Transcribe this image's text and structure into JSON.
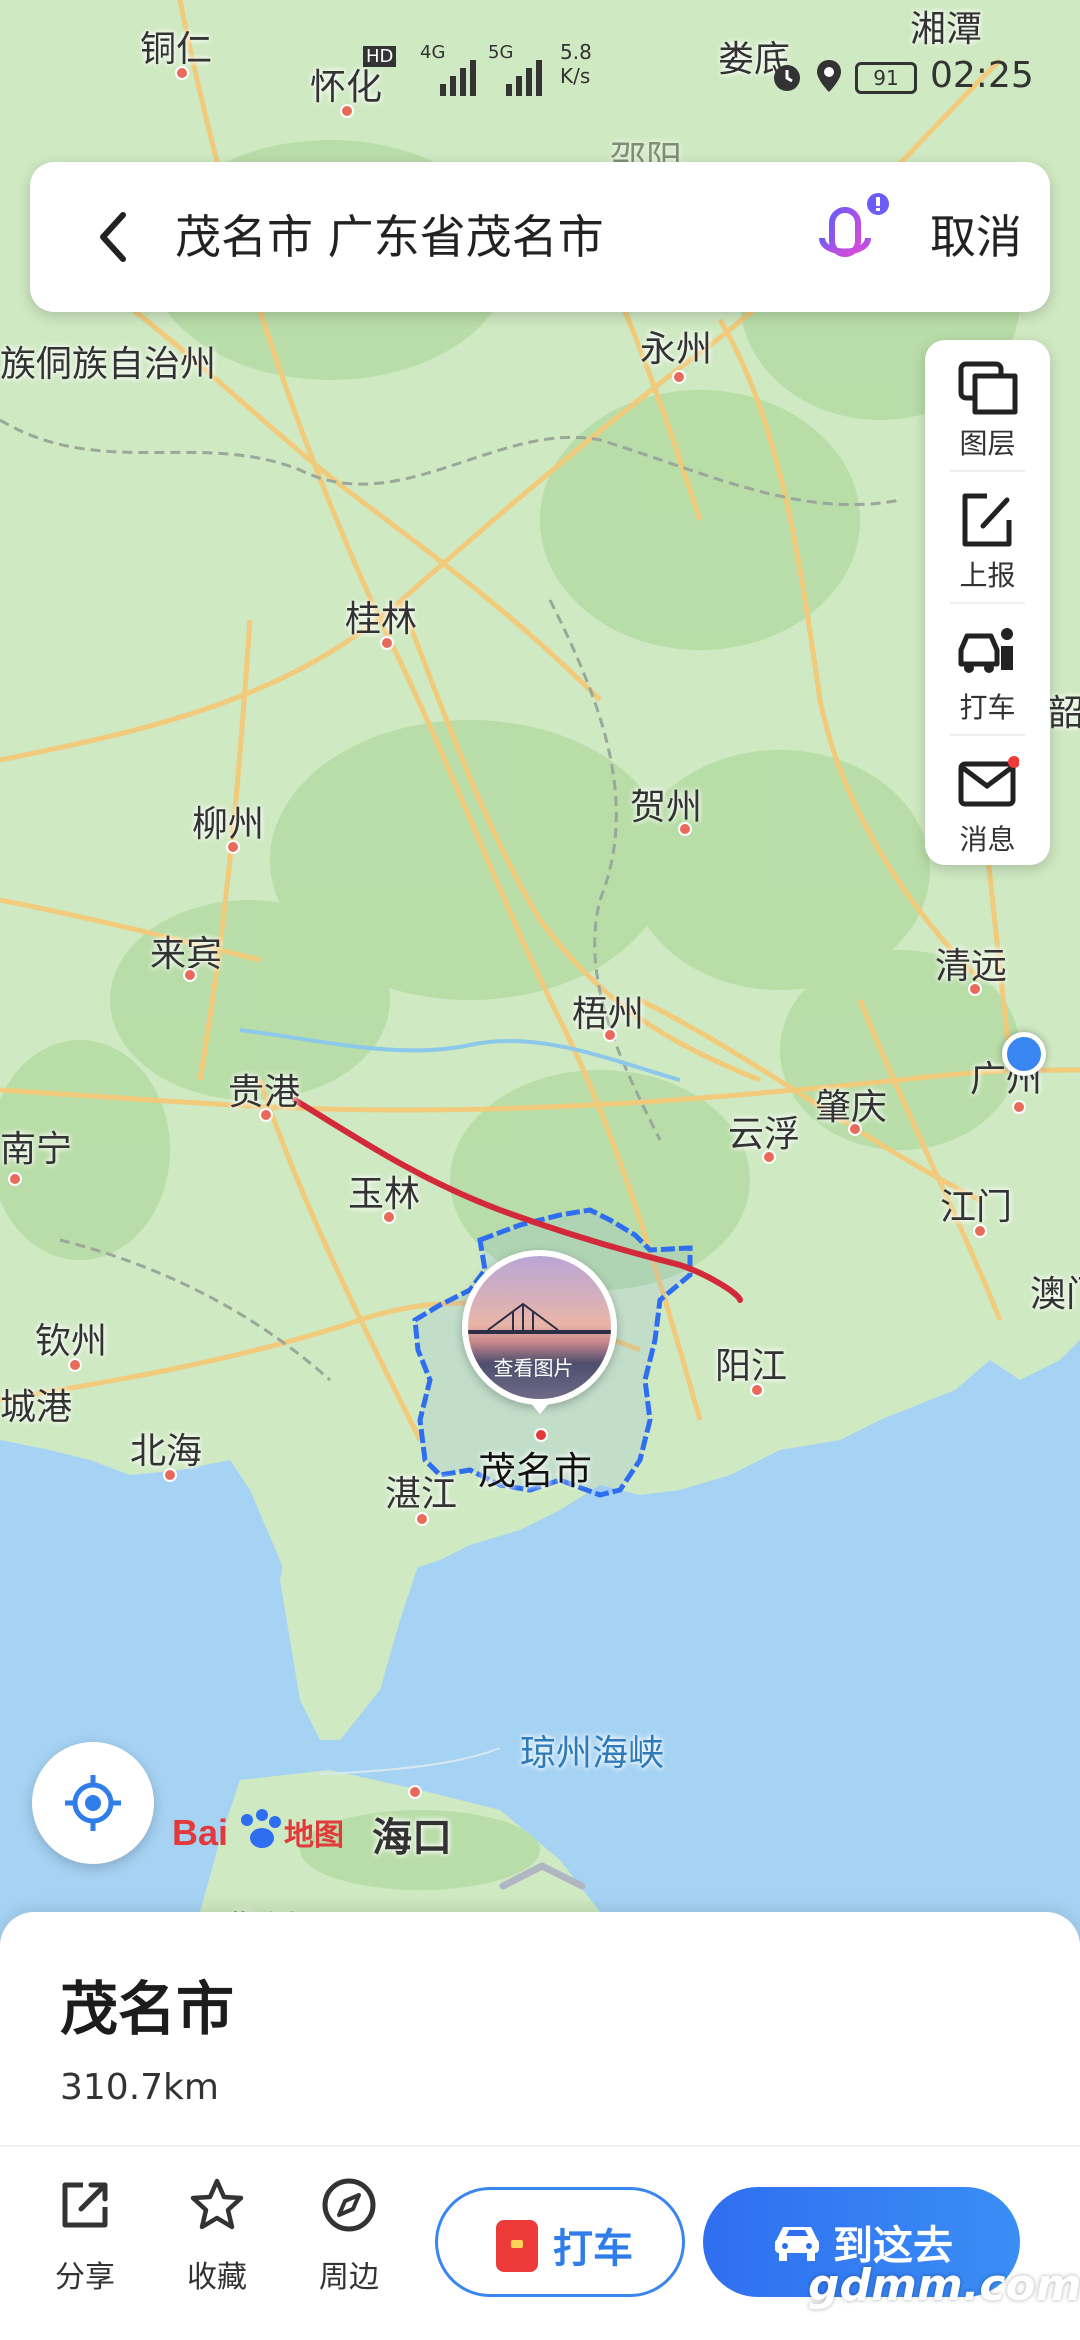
{
  "status_bar": {
    "signal_left": "HD",
    "net_4g": "4G",
    "net_5g": "5G",
    "speed": "5.8\nK/s",
    "battery": "91",
    "time": "02:25"
  },
  "search": {
    "query": "茂名市 广东省茂名市",
    "cancel_label": "取消"
  },
  "tools": [
    {
      "label": "图层",
      "icon": "layers-icon"
    },
    {
      "label": "上报",
      "icon": "report-edit-icon"
    },
    {
      "label": "打车",
      "icon": "taxi-driver-icon"
    },
    {
      "label": "消息",
      "icon": "mail-icon"
    }
  ],
  "map": {
    "labels": [
      {
        "text": "铜仁"
      },
      {
        "text": "怀化"
      },
      {
        "text": "娄底"
      },
      {
        "text": "湘潭"
      },
      {
        "text": "邵阳"
      },
      {
        "text": "族侗族自治州"
      },
      {
        "text": "永州"
      },
      {
        "text": "桂林"
      },
      {
        "text": "韶"
      },
      {
        "text": "柳州"
      },
      {
        "text": "贺州"
      },
      {
        "text": "来宾"
      },
      {
        "text": "清远"
      },
      {
        "text": "梧州"
      },
      {
        "text": "贵港"
      },
      {
        "text": "广州"
      },
      {
        "text": "肇庆"
      },
      {
        "text": "云浮"
      },
      {
        "text": "南宁"
      },
      {
        "text": "玉林"
      },
      {
        "text": "江门"
      },
      {
        "text": "澳门"
      },
      {
        "text": "钦州"
      },
      {
        "text": "阳江"
      },
      {
        "text": "城港"
      },
      {
        "text": "北海"
      },
      {
        "text": "湛江"
      },
      {
        "text": "琼州海峡"
      },
      {
        "text": "海口"
      },
      {
        "text": "儋州"
      }
    ],
    "selected_city": "茂名市",
    "photo_caption": "查看图片",
    "brand": "Bai地图"
  },
  "place_card": {
    "title": "茂名市",
    "distance": "310.7km"
  },
  "actions": [
    {
      "label": "分享",
      "icon": "share-icon"
    },
    {
      "label": "收藏",
      "icon": "star-icon"
    },
    {
      "label": "周边",
      "icon": "compass-icon"
    }
  ],
  "buttons": {
    "taxi": "打车",
    "go": "到这去"
  },
  "watermark": "gdmm.com",
  "colors": {
    "accent": "#3a86f0",
    "route": "#d22a3a",
    "boundary": "#2f6ef0",
    "land": "#cfe9c2",
    "sea": "#9fd0f3"
  }
}
